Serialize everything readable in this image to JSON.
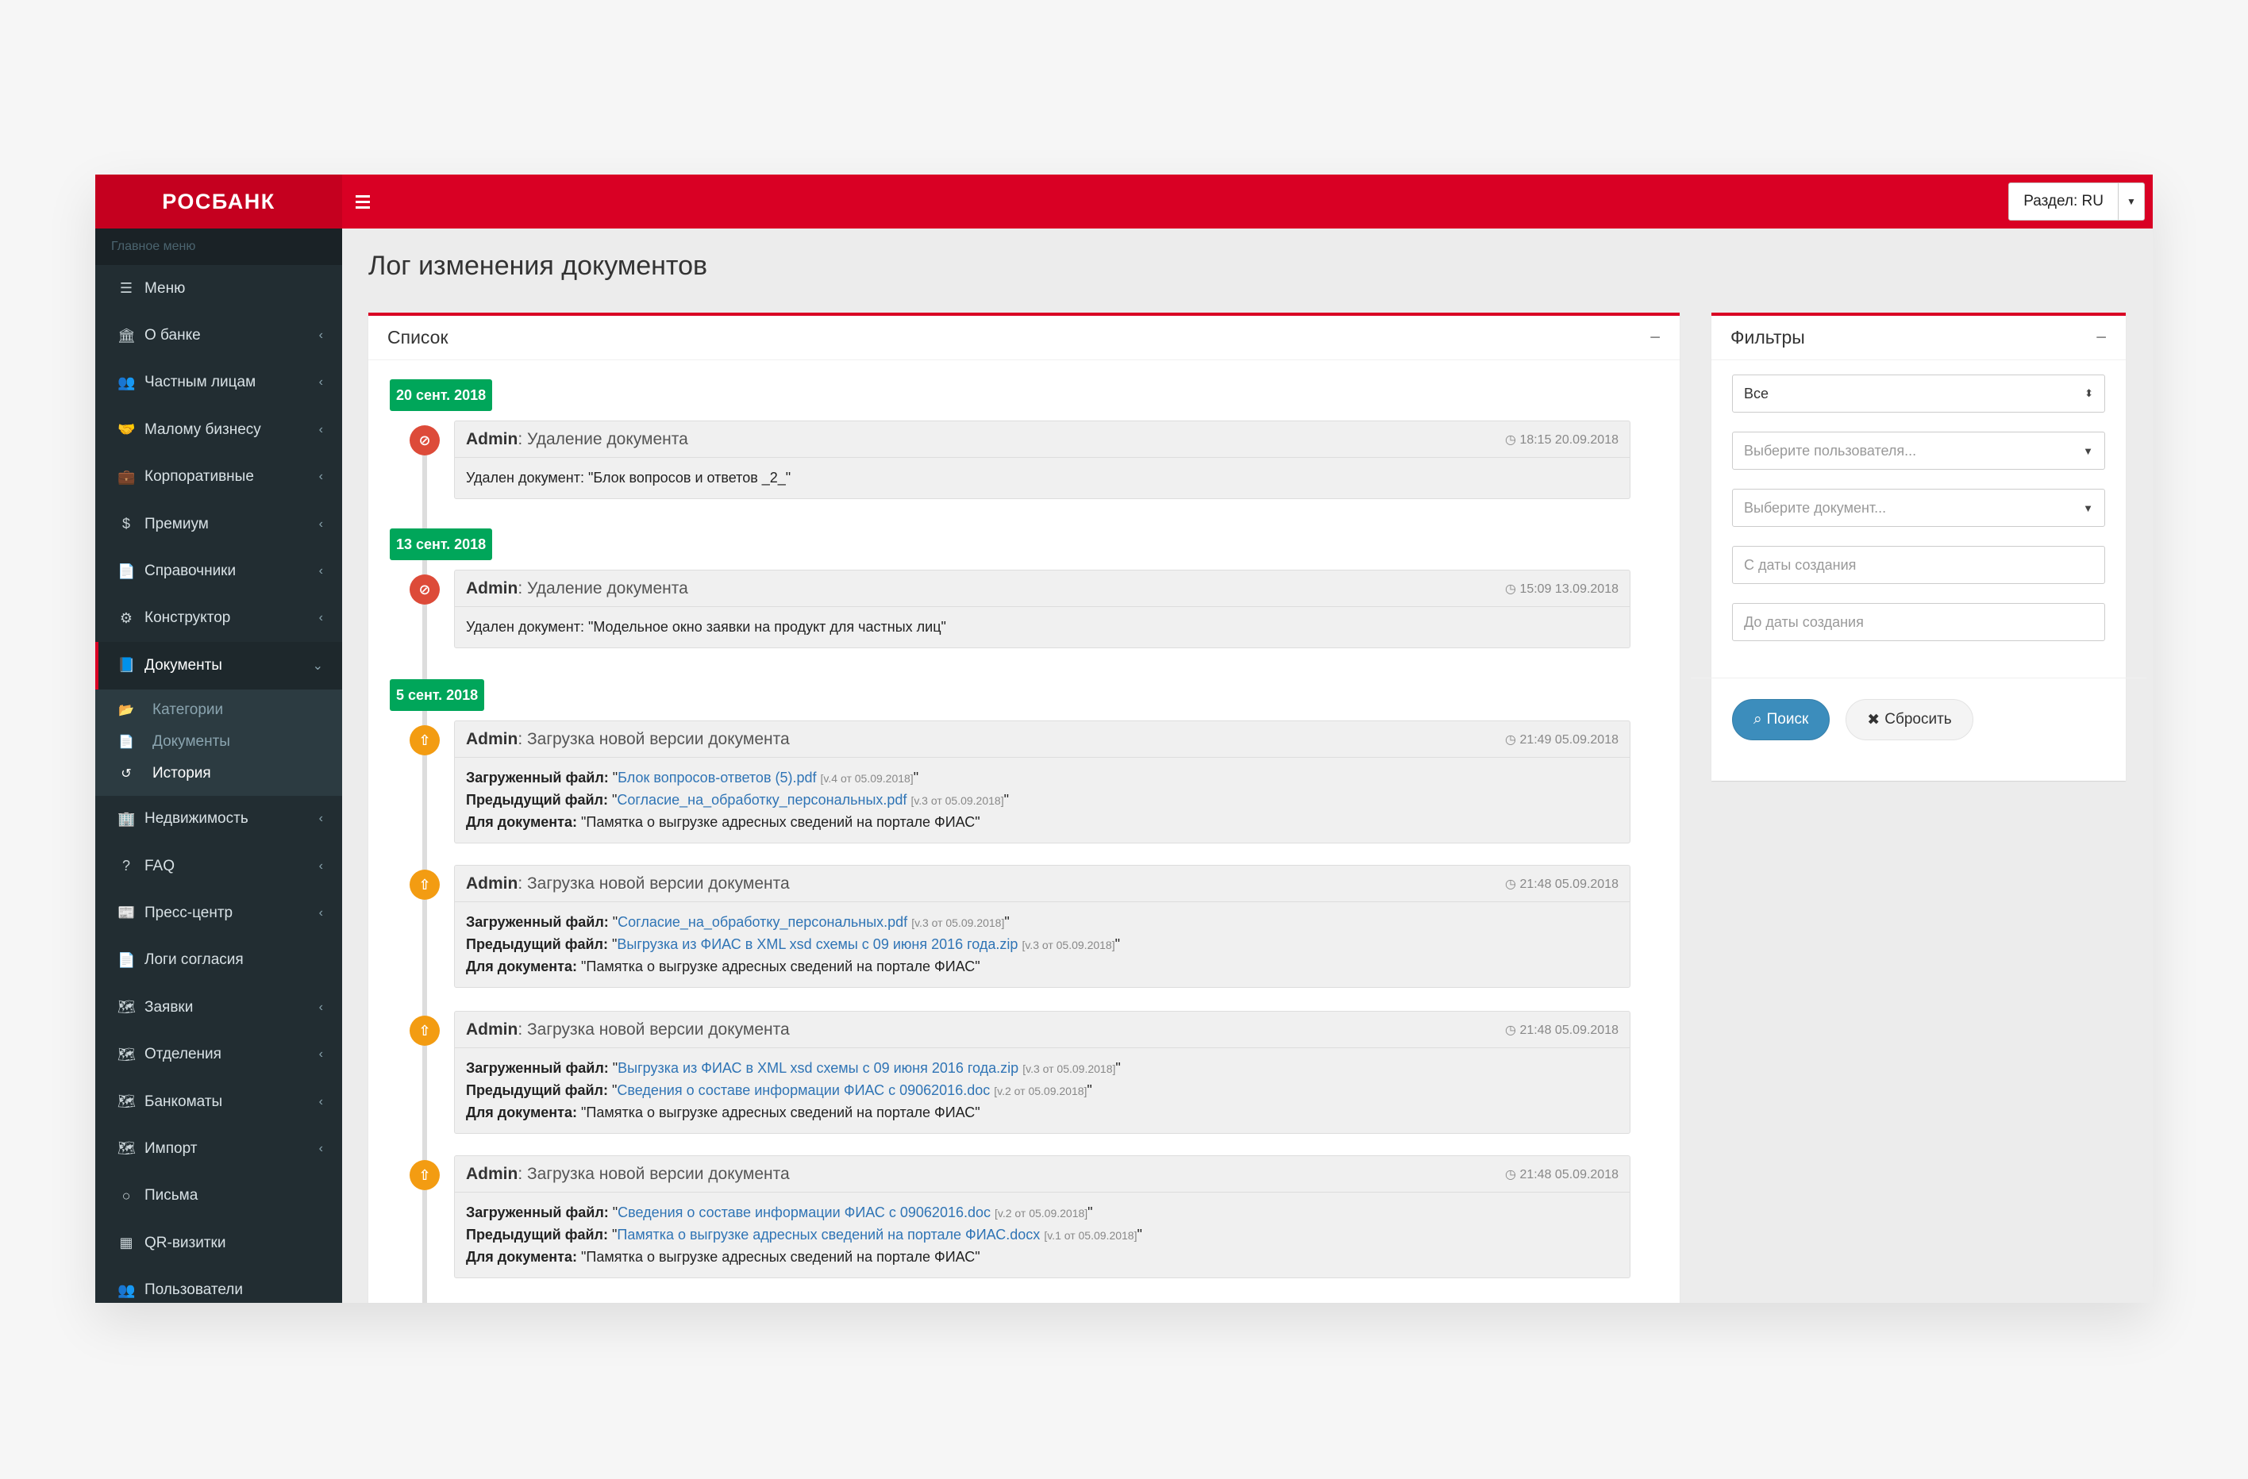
{
  "header": {
    "logo": "РОСБАНК",
    "section_select": "Раздел: RU"
  },
  "sidebar": {
    "header": "Главное меню",
    "items": [
      {
        "label": "Меню",
        "icon": "list-icon",
        "glyph": "☰"
      },
      {
        "label": "О банке",
        "icon": "bank-icon",
        "glyph": "🏛"
      },
      {
        "label": "Частным лицам",
        "icon": "users-icon",
        "glyph": "👥"
      },
      {
        "label": "Малому бизнесу",
        "icon": "handshake-icon",
        "glyph": "🤝"
      },
      {
        "label": "Корпоративные",
        "icon": "briefcase-icon",
        "glyph": "💼"
      },
      {
        "label": "Премиум",
        "icon": "dollar-icon",
        "glyph": "$"
      },
      {
        "label": "Справочники",
        "icon": "file-icon",
        "glyph": "📄"
      },
      {
        "label": "Конструктор",
        "icon": "cubes-icon",
        "glyph": "⚙"
      },
      {
        "label": "Документы",
        "icon": "book-icon",
        "glyph": "📘"
      },
      {
        "label": "Недвижимость",
        "icon": "building-icon",
        "glyph": "🏢"
      },
      {
        "label": "FAQ",
        "icon": "question-icon",
        "glyph": "?"
      },
      {
        "label": "Пресс-центр",
        "icon": "newspaper-icon",
        "glyph": "📰"
      },
      {
        "label": "Логи согласия",
        "icon": "file-text-icon",
        "glyph": "📄"
      },
      {
        "label": "Заявки",
        "icon": "map-icon",
        "glyph": "🗺"
      },
      {
        "label": "Отделения",
        "icon": "map-icon",
        "glyph": "🗺"
      },
      {
        "label": "Банкоматы",
        "icon": "map-icon",
        "glyph": "🗺"
      },
      {
        "label": "Импорт",
        "icon": "map-icon",
        "glyph": "🗺"
      },
      {
        "label": "Письма",
        "icon": "circle-icon",
        "glyph": "○"
      },
      {
        "label": "QR-визитки",
        "icon": "qrcode-icon",
        "glyph": "▦"
      },
      {
        "label": "Пользователи",
        "icon": "users-icon",
        "glyph": "👥"
      }
    ],
    "submenu": [
      {
        "label": "Категории",
        "icon": "folder-open-icon",
        "glyph": "📂"
      },
      {
        "label": "Документы",
        "icon": "document-icon",
        "glyph": "📄"
      },
      {
        "label": "История",
        "icon": "history-icon",
        "glyph": "↺"
      }
    ]
  },
  "page": {
    "title": "Лог изменения документов"
  },
  "list": {
    "title": "Список",
    "collapse": "−",
    "dates": [
      "20 сент. 2018",
      "13 сент. 2018",
      "5 сент. 2018"
    ],
    "entries": [
      {
        "user": "Admin",
        "action": ": Удаление документа",
        "time": "18:15 20.09.2018",
        "text": "Удален документ: \"Блок вопросов и ответов _2_\""
      },
      {
        "user": "Admin",
        "action": ": Удаление документа",
        "time": "15:09 13.09.2018",
        "text": "Удален документ: \"Модельное окно заявки на продукт для частных лиц\""
      },
      {
        "user": "Admin",
        "action": ": Загрузка новой версии документа",
        "time": "21:49 05.09.2018",
        "uploaded_label": "Загруженный файл:",
        "uploaded_file": "Блок вопросов-ответов (5).pdf",
        "uploaded_ver": "[v.4 от 05.09.2018]",
        "prev_label": "Предыдущий файл:",
        "prev_file": "Согласие_на_обработку_персональных.pdf",
        "prev_ver": "[v.3 от 05.09.2018]",
        "doc_label": "Для документа:",
        "doc_name": "\"Памятка о выгрузке адресных сведений на портале ФИАС\""
      },
      {
        "user": "Admin",
        "action": ": Загрузка новой версии документа",
        "time": "21:48 05.09.2018",
        "uploaded_label": "Загруженный файл:",
        "uploaded_file": "Согласие_на_обработку_персональных.pdf",
        "uploaded_ver": "[v.3 от 05.09.2018]",
        "prev_label": "Предыдущий файл:",
        "prev_file": "Выгрузка из ФИАС в XML xsd схемы с 09 июня 2016 года.zip",
        "prev_ver": "[v.3 от 05.09.2018]",
        "doc_label": "Для документа:",
        "doc_name": "\"Памятка о выгрузке адресных сведений на портале ФИАС\""
      },
      {
        "user": "Admin",
        "action": ": Загрузка новой версии документа",
        "time": "21:48 05.09.2018",
        "uploaded_label": "Загруженный файл:",
        "uploaded_file": "Выгрузка из ФИАС в XML xsd схемы с 09 июня 2016 года.zip",
        "uploaded_ver": "[v.3 от 05.09.2018]",
        "prev_label": "Предыдущий файл:",
        "prev_file": "Сведения о составе информации ФИАС с 09062016.doc",
        "prev_ver": "[v.2 от 05.09.2018]",
        "doc_label": "Для документа:",
        "doc_name": "\"Памятка о выгрузке адресных сведений на портале ФИАС\""
      },
      {
        "user": "Admin",
        "action": ": Загрузка новой версии документа",
        "time": "21:48 05.09.2018",
        "uploaded_label": "Загруженный файл:",
        "uploaded_file": "Сведения о составе информации ФИАС с 09062016.doc",
        "uploaded_ver": "[v.2 от 05.09.2018]",
        "prev_label": "Предыдущий файл:",
        "prev_file": "Памятка о выгрузке адресных сведений на портале ФИАС.docx",
        "prev_ver": "[v.1 от 05.09.2018]",
        "doc_label": "Для документа:",
        "doc_name": "\"Памятка о выгрузке адресных сведений на портале ФИАС\""
      }
    ]
  },
  "filters": {
    "title": "Фильтры",
    "collapse": "−",
    "type_value": "Все",
    "user_placeholder": "Выберите пользователя...",
    "document_placeholder": "Выберите документ...",
    "date_from_placeholder": "С даты создания",
    "date_to_placeholder": "До даты создания",
    "search_label": "Поиск",
    "reset_label": "Сбросить"
  },
  "colors": {
    "brand_red": "#d90024",
    "sidebar_bg": "#222d32",
    "date_green": "#00a65a",
    "delete_red": "#dd4b39",
    "upload_orange": "#f39c12",
    "link_blue": "#2f74b5",
    "button_blue": "#3c8dbc"
  }
}
